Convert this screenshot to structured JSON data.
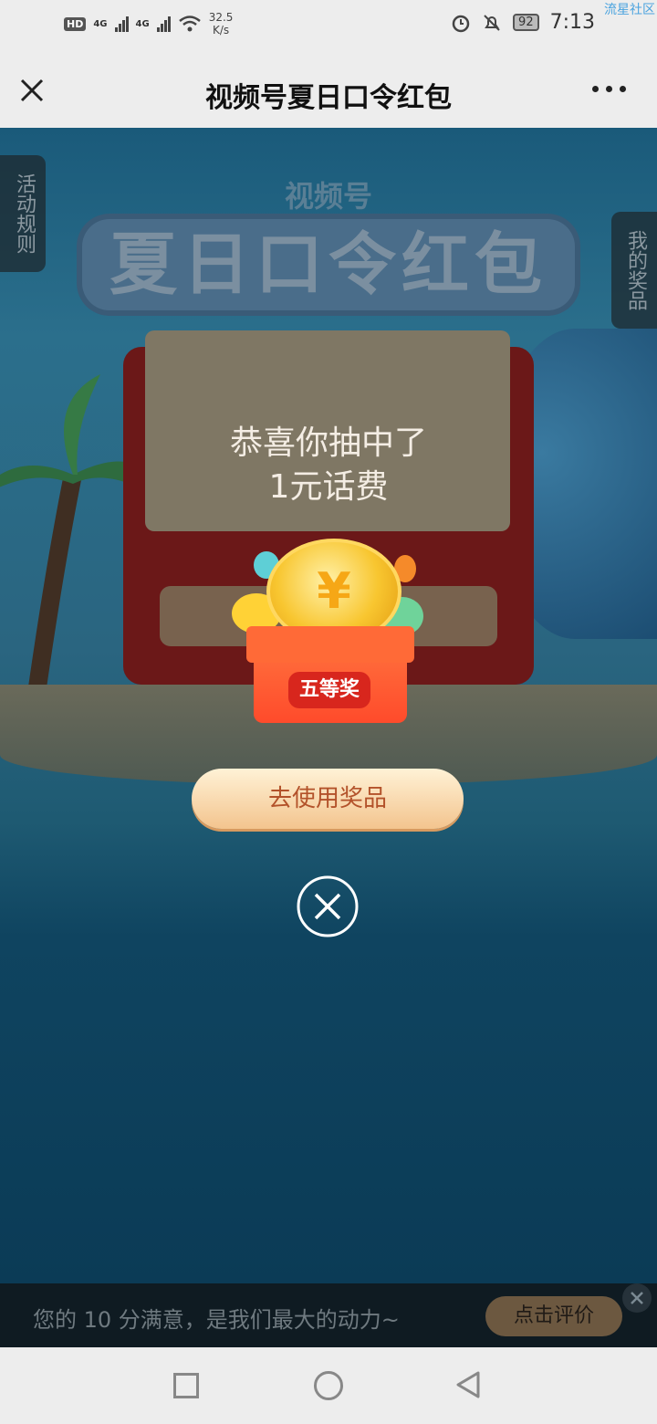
{
  "status_bar": {
    "hd": "HD",
    "net1": "4G",
    "net2": "4G",
    "speed_value": "32.5",
    "speed_unit": "K/s",
    "battery": "92",
    "time": "7:13",
    "watermark": "流星社区"
  },
  "header": {
    "title": "视频号夏日口令红包"
  },
  "scene": {
    "title_small": "视频号",
    "title_big": "夏日口令红包",
    "left_tab": "活动规则",
    "right_tab": "我的奖品"
  },
  "modal": {
    "congrats_text": "恭喜你抽中了",
    "prize_name": "1元话费",
    "prize_level": "五等奖",
    "coin_symbol": "¥",
    "use_button_label": "去使用奖品"
  },
  "rating": {
    "text": "您的 10 分满意，是我们最大的动力~",
    "button_label": "点击评价"
  },
  "colors": {
    "accent": "#f3c48e",
    "badge": "#d8261d",
    "box": "#ff6a37"
  }
}
